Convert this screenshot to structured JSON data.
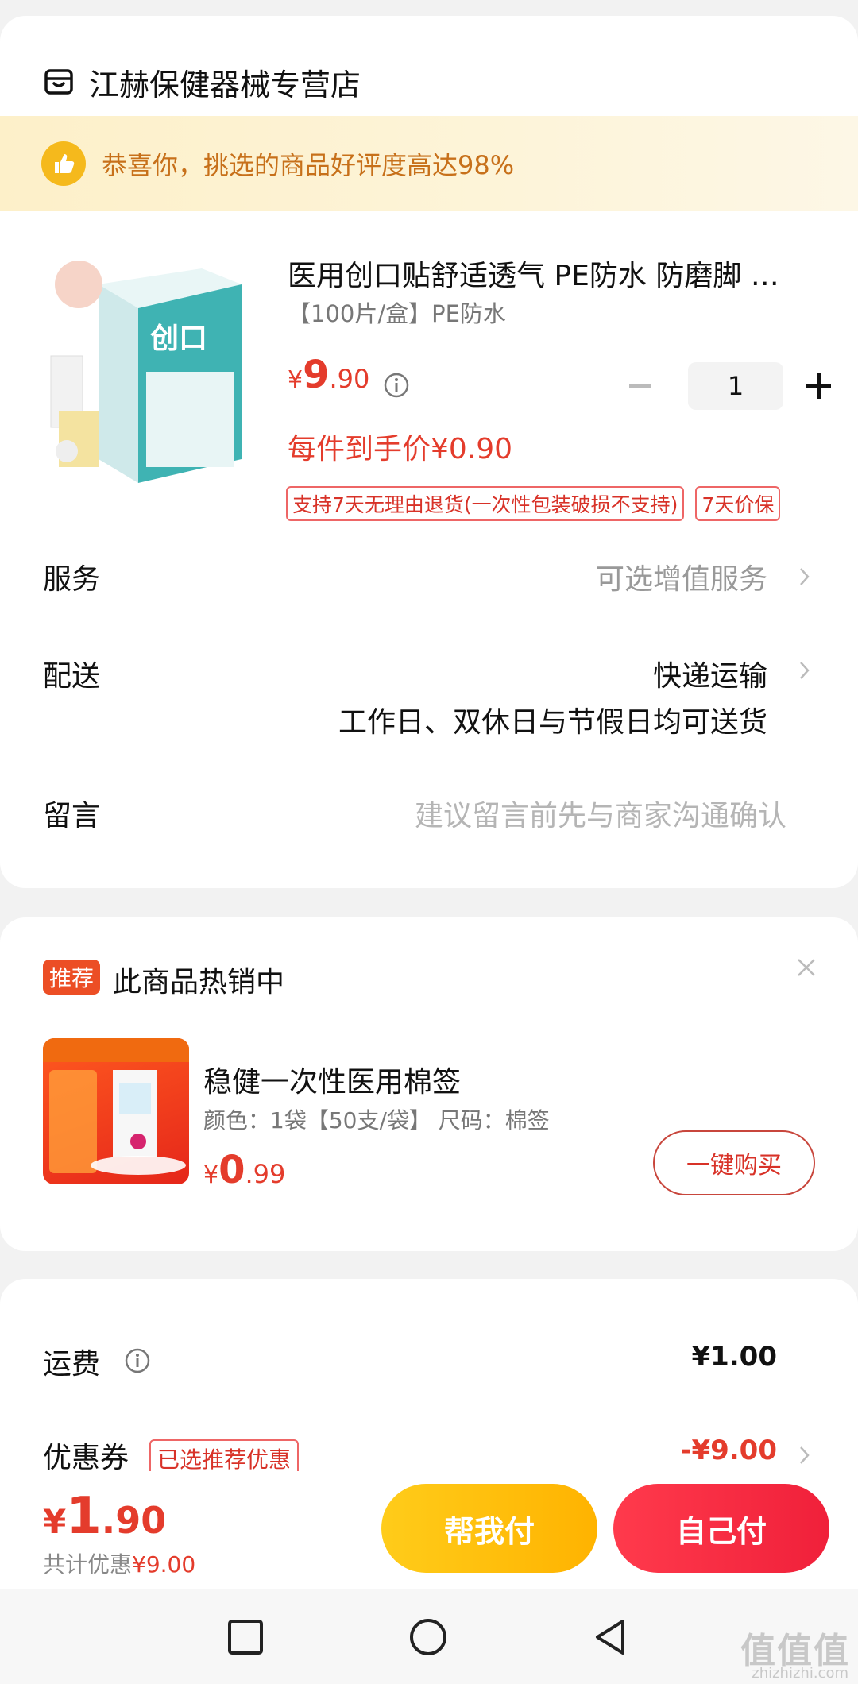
{
  "store": {
    "name": "江赫保健器械专营店"
  },
  "banner": {
    "text": "恭喜你，挑选的商品好评度高达98%"
  },
  "product": {
    "title": "医用创口贴舒适透气 PE防水 防磨脚 …",
    "spec": "【100片/盒】PE防水",
    "price_currency": "¥",
    "price_int": "9",
    "price_dec": ".90",
    "quantity": "1",
    "final_price": "每件到手价¥0.90",
    "tags": [
      "支持7天无理由退货(一次性包装破损不支持)",
      "7天价保"
    ]
  },
  "rows": {
    "service_label": "服务",
    "service_value": "可选增值服务",
    "delivery_label": "配送",
    "delivery_value": "快递运输",
    "delivery_note": "工作日、双休日与节假日均可送货",
    "message_label": "留言",
    "message_placeholder": "建议留言前先与商家沟通确认"
  },
  "recommend": {
    "badge": "推荐",
    "title": "此商品热销中",
    "item_name": "稳健一次性医用棉签",
    "item_spec": "颜色：1袋【50支/袋】   尺码：棉签",
    "price_currency": "¥",
    "price_int": "0",
    "price_dec": ".99",
    "buy_label": "一键购买"
  },
  "fees": {
    "shipping_label": "运费",
    "shipping_value": "¥1.00",
    "coupon_label": "优惠券",
    "coupon_tag": "已选推荐优惠",
    "coupon_value": "-¥9.00"
  },
  "footer": {
    "total_currency": "¥",
    "total_int": "1",
    "total_dec": ".90",
    "discount_prefix": "共计优惠",
    "discount_value": "¥9.00",
    "help_pay": "帮我付",
    "self_pay": "自己付"
  },
  "watermark": {
    "main": "值值值",
    "sub": "zhizhizhi.com"
  },
  "colors": {
    "accent_red": "#e43c2c",
    "yellow_button": "#ffc107",
    "red_button": "#f0203a"
  }
}
